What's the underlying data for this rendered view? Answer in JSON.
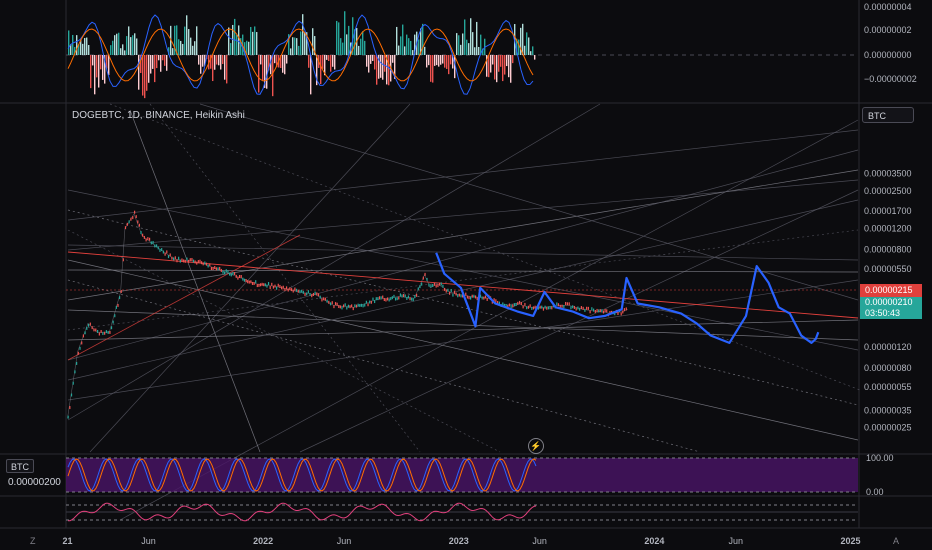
{
  "header": {
    "symbol_title": "DOGEBTC, 1D, BINANCE, Heikin Ashi"
  },
  "controls": {
    "currency_button": "BTC",
    "left_currency": "BTC",
    "left_value": "0.00000200",
    "zoom_left": "Z",
    "zoom_right": "A",
    "replay_icon": "lightning-icon"
  },
  "colors": {
    "background": "#0c0c0f",
    "price_line": "#2962ff",
    "candle_up": "#26a69a",
    "candle_down": "#ef5350",
    "trend_line": "#e0403c",
    "oscillator_fill": "#4a1466"
  },
  "price_tags": {
    "red": "0.00000215",
    "green": "0.00000210",
    "countdown": "03:50:43"
  },
  "chart_data": [
    {
      "id": "macd",
      "type": "bar",
      "panel": "top",
      "y_ticks": [
        "0.00000004",
        "0.00000002",
        "0.00000000",
        "−0.00000002"
      ]
    },
    {
      "id": "price",
      "type": "line",
      "panel": "main",
      "scale": "log",
      "title": "DOGEBTC, 1D, BINANCE, Heikin Ashi",
      "x_ticks": [
        "21",
        "Jun",
        "2022",
        "Jun",
        "2023",
        "Jun",
        "2024",
        "Jun",
        "2025"
      ],
      "y_ticks": [
        "0.00003500",
        "0.00002500",
        "0.00001700",
        "0.00001200",
        "0.00000800",
        "0.00000550",
        "0.00000350",
        "0.00000120",
        "0.00000080",
        "0.00000055",
        "0.00000035",
        "0.00000025"
      ],
      "series": [
        {
          "x": [
            "2021-01-01",
            "2021-01-20",
            "2021-02-08",
            "2021-02-25",
            "2021-03-20",
            "2021-04-10",
            "2021-04-18",
            "2021-05-05",
            "2021-05-20",
            "2021-06-15",
            "2021-07-20",
            "2021-08-20",
            "2021-09-10",
            "2021-10-20",
            "2021-11-20",
            "2021-12-20",
            "2022-01-25",
            "2022-02-25",
            "2022-04-10",
            "2022-05-12",
            "2022-06-20",
            "2022-07-30",
            "2022-09-10",
            "2022-10-10",
            "2022-10-29",
            "2022-11-09",
            "2022-11-22",
            "2022-12-20",
            "2023-01-25",
            "2023-02-25",
            "2023-03-20",
            "2023-04-20",
            "2023-05-10",
            "2023-06-10",
            "2023-07-05",
            "2023-07-25",
            "2023-08-20",
            "2023-09-15",
            "2023-10-15",
            "2023-11-05",
            "2023-11-12"
          ],
          "values": [
            3e-07,
            1.1e-06,
            1.9e-06,
            1.6e-06,
            1.6e-06,
            3.5e-06,
            1.2e-05,
            1.6e-05,
            1.05e-05,
            8.5e-06,
            6.6e-06,
            6.4e-06,
            6.1e-06,
            5.2e-06,
            4.6e-06,
            4.1e-06,
            3.9e-06,
            3.6e-06,
            3.3e-06,
            2.7e-06,
            2.6e-06,
            3e-06,
            3.2e-06,
            3.1e-06,
            4.9e-06,
            3.8e-06,
            4.1e-06,
            3.4e-06,
            3.2e-06,
            3.1e-06,
            2.7e-06,
            2.8e-06,
            2.6e-06,
            2.6e-06,
            2.7e-06,
            2.7e-06,
            2.5e-06,
            2.4e-06,
            2.3e-06,
            2.4e-06,
            2.5e-06
          ]
        },
        {
          "color": "#2962ff",
          "x": [
            "2022-11-20",
            "2022-12-05",
            "2023-01-05",
            "2023-02-01",
            "2023-02-10",
            "2023-03-10",
            "2023-04-20",
            "2023-05-20",
            "2023-06-10",
            "2023-07-01",
            "2023-08-01",
            "2023-09-01",
            "2023-10-01",
            "2023-11-01",
            "2023-11-10",
            "2023-12-01",
            "2024-01-10",
            "2024-02-20",
            "2024-03-20",
            "2024-04-15",
            "2024-05-20",
            "2024-06-20",
            "2024-07-10",
            "2024-08-01",
            "2024-08-20",
            "2024-09-10",
            "2024-10-01",
            "2024-10-20",
            "2024-10-28",
            "2024-11-02"
          ],
          "values": [
            7.5e-06,
            5e-06,
            3.8e-06,
            1.8e-06,
            3.8e-06,
            2.8e-06,
            2.4e-06,
            2.2e-06,
            3.5e-06,
            2.6e-06,
            2.4e-06,
            2.1e-06,
            2.2e-06,
            2.5e-06,
            4.6e-06,
            2.8e-06,
            2.6e-06,
            2.3e-06,
            1.9e-06,
            1.5e-06,
            1.3e-06,
            2.2e-06,
            5.8e-06,
            4.2e-06,
            2.6e-06,
            2.3e-06,
            1.5e-06,
            1.3e-06,
            1.4e-06,
            1.6e-06
          ]
        }
      ]
    },
    {
      "id": "stoch_rsi",
      "type": "line",
      "panel": "lower1",
      "y_ticks": [
        "100.00",
        "0.00"
      ]
    },
    {
      "id": "oscillator2",
      "type": "line",
      "panel": "lower2"
    }
  ]
}
